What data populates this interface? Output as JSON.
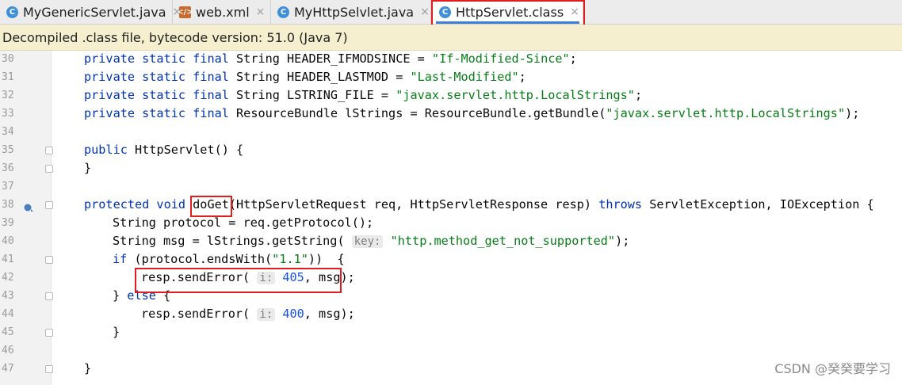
{
  "tabs": [
    {
      "label": "MyGenericServlet.java",
      "icon": "java-class-icon",
      "active": false
    },
    {
      "label": "web.xml",
      "icon": "xml-file-icon",
      "active": false
    },
    {
      "label": "MyHttpSelvlet.java",
      "icon": "java-class-icon",
      "active": false
    },
    {
      "label": "HttpServlet.class",
      "icon": "java-class-icon",
      "active": true
    }
  ],
  "close_glyph": "×",
  "banner": {
    "text": "Decompiled .class file, bytecode version: 51.0 (Java 7)"
  },
  "lines": [
    {
      "n": "30",
      "tokens": [
        [
          "kw",
          "private static final "
        ],
        [
          "",
          "String HEADER_IFMODSINCE = "
        ],
        [
          "str",
          "\"If-Modified-Since\""
        ],
        [
          "",
          ";"
        ]
      ]
    },
    {
      "n": "31",
      "tokens": [
        [
          "kw",
          "private static final "
        ],
        [
          "",
          "String HEADER_LASTMOD = "
        ],
        [
          "str",
          "\"Last-Modified\""
        ],
        [
          "",
          ";"
        ]
      ]
    },
    {
      "n": "32",
      "tokens": [
        [
          "kw",
          "private static final "
        ],
        [
          "",
          "String LSTRING_FILE = "
        ],
        [
          "str",
          "\"javax.servlet.http.LocalStrings\""
        ],
        [
          "",
          ";"
        ]
      ]
    },
    {
      "n": "33",
      "tokens": [
        [
          "kw",
          "private static final "
        ],
        [
          "",
          "ResourceBundle lStrings = ResourceBundle.getBundle("
        ],
        [
          "str",
          "\"javax.servlet.http.LocalStrings\""
        ],
        [
          "",
          ");"
        ]
      ]
    },
    {
      "n": "34",
      "tokens": []
    },
    {
      "n": "35",
      "tokens": [
        [
          "kw",
          "public "
        ],
        [
          "",
          "HttpServlet() {"
        ]
      ]
    },
    {
      "n": "36",
      "tokens": [
        [
          "",
          "}"
        ]
      ]
    },
    {
      "n": "37",
      "tokens": []
    },
    {
      "n": "38",
      "tokens": [
        [
          "kw",
          "protected void "
        ],
        [
          "",
          "doGet(HttpServletRequest req, HttpServletResponse resp) "
        ],
        [
          "kw",
          "throws "
        ],
        [
          "",
          "ServletException, IOException {"
        ]
      ]
    },
    {
      "n": "39",
      "tokens": [
        [
          "",
          "String protocol = req.getProtocol();"
        ]
      ]
    },
    {
      "n": "40",
      "tokens": [
        [
          "",
          "String msg = lStrings.getString( "
        ],
        [
          "hint",
          "key:"
        ],
        [
          "",
          " "
        ],
        [
          "str",
          "\"http.method_get_not_supported\""
        ],
        [
          "",
          ");"
        ]
      ]
    },
    {
      "n": "41",
      "tokens": [
        [
          "kw",
          "if "
        ],
        [
          "",
          "(protocol.endsWith("
        ],
        [
          "str",
          "\"1.1\""
        ],
        [
          "",
          "))  {"
        ]
      ]
    },
    {
      "n": "42",
      "tokens": [
        [
          "",
          "resp.sendError( "
        ],
        [
          "hint",
          "i:"
        ],
        [
          "",
          " "
        ],
        [
          "num",
          "405"
        ],
        [
          "",
          ", msg);"
        ]
      ]
    },
    {
      "n": "43",
      "tokens": [
        [
          "",
          "} "
        ],
        [
          "kw",
          "else "
        ],
        [
          "",
          "{"
        ]
      ]
    },
    {
      "n": "44",
      "tokens": [
        [
          "",
          "resp.sendError( "
        ],
        [
          "hint",
          "i:"
        ],
        [
          "",
          " "
        ],
        [
          "num",
          "400"
        ],
        [
          "",
          ", msg);"
        ]
      ]
    },
    {
      "n": "45",
      "tokens": [
        [
          "",
          "}"
        ]
      ]
    },
    {
      "n": "46",
      "tokens": []
    },
    {
      "n": "47",
      "tokens": [
        [
          "",
          "}"
        ]
      ]
    }
  ],
  "watermark": "CSDN @癸癸要学习",
  "colors": {
    "keyword": "#0033b3",
    "string": "#067d17",
    "number": "#1750eb",
    "highlight_box": "#e31d1d",
    "banner_bg": "#f6efcf"
  }
}
